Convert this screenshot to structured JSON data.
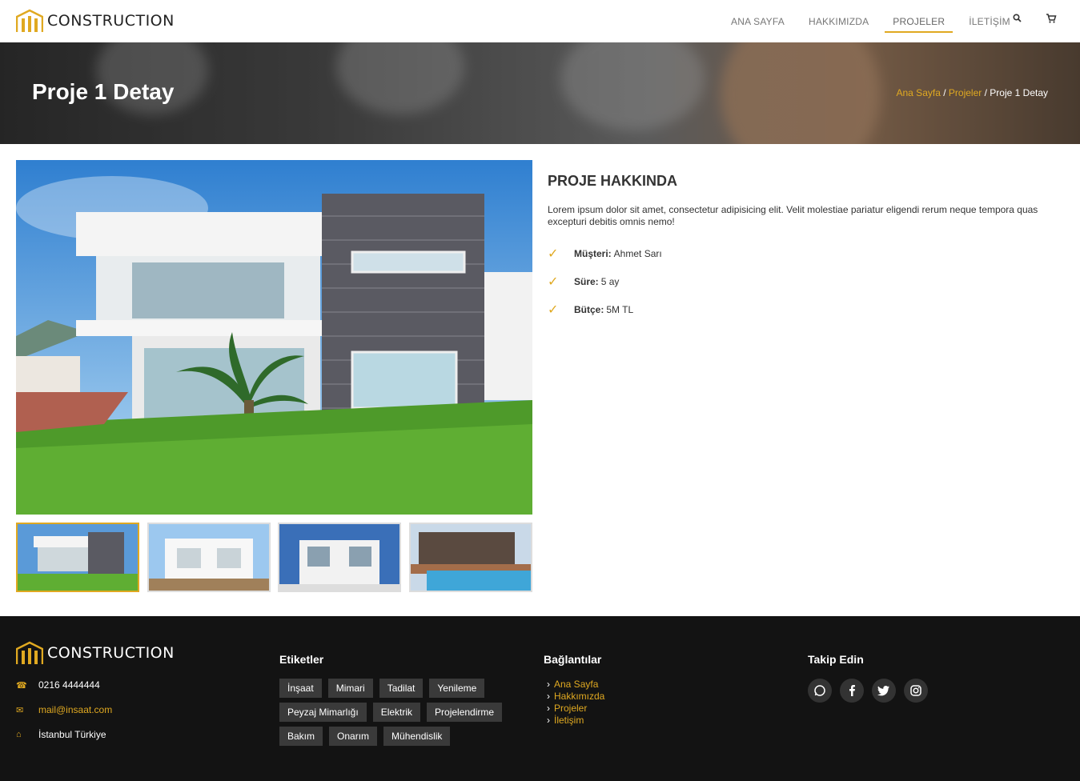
{
  "brand": {
    "name": "CONSTRUCTION",
    "accent": "#e0a921"
  },
  "nav": {
    "items": [
      {
        "label": "ANA SAYFA"
      },
      {
        "label": "HAKKIMIZDA"
      },
      {
        "label": "PROJELER"
      },
      {
        "label": "İLETİŞİM"
      }
    ],
    "active": "PROJELER",
    "icons": [
      "search-icon",
      "cart-icon"
    ]
  },
  "hero": {
    "title": "Proje 1 Detay",
    "breadcrumb": [
      {
        "label": "Ana Sayfa"
      },
      {
        "sep": "/"
      },
      {
        "label": "Projeler"
      },
      {
        "sep2": "/"
      },
      {
        "label": "Proje 1 Detay"
      }
    ]
  },
  "project": {
    "heading": "PROJE HAKKINDA",
    "description": "Lorem ipsum dolor sit amet, consectetur adipisicing elit. Velit molestiae pariatur eligendi rerum neque tempora quas excepturi debitis omnis nemo!",
    "specs": [
      {
        "label": "Müşteri:",
        "value": "Ahmet Sarı"
      },
      {
        "label": "Süre:",
        "value": "5 ay"
      },
      {
        "label": "Bütçe:",
        "value": "5M TL"
      }
    ]
  },
  "footer": {
    "phone": "0216 4444444",
    "email": "mail@insaat.com",
    "address": "İstanbul Türkiye",
    "tags_title": "Etiketler",
    "tags": [
      "İnşaat",
      "Mimari",
      "Tadilat",
      "Yenileme",
      "Peyzaj Mimarlığı",
      "Elektrik",
      "Projelendirme",
      "Bakım",
      "Onarım",
      "Mühendislik"
    ],
    "links_title": "Bağlantılar",
    "links": [
      "Ana Sayfa",
      "Hakkımızda",
      "Projeler",
      "İletişim"
    ],
    "social_title": "Takip Edin",
    "social": [
      "whatsapp-icon",
      "facebook-icon",
      "twitter-icon",
      "instagram-icon"
    ]
  }
}
